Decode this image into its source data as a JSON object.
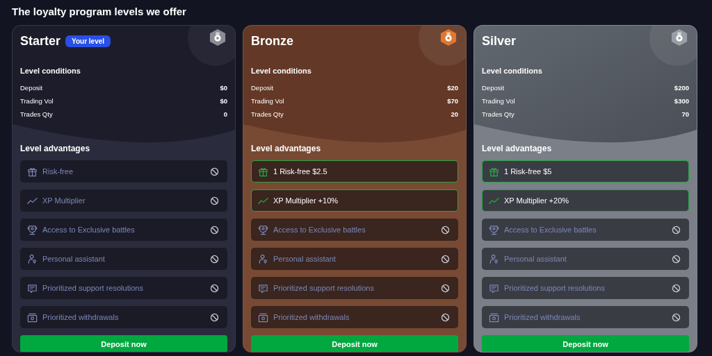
{
  "heading": "The loyalty program levels we offer",
  "levels": [
    {
      "kind": "starter",
      "name": "Starter",
      "badge": "Your level",
      "conditions_title": "Level conditions",
      "conditions": [
        {
          "label": "Deposit",
          "value": "$0"
        },
        {
          "label": "Trading Vol",
          "value": "$0"
        },
        {
          "label": "Trades Qty",
          "value": "0"
        }
      ],
      "advantages_title": "Level advantages",
      "advantages": [
        {
          "kind": "gift",
          "label": "Risk-free",
          "unlocked": false
        },
        {
          "kind": "trend",
          "label": "XP Multiplier",
          "unlocked": false
        },
        {
          "kind": "trophy",
          "label": "Access to Exclusive battles",
          "unlocked": false
        },
        {
          "kind": "person",
          "label": "Personal assistant",
          "unlocked": false
        },
        {
          "kind": "chat",
          "label": "Prioritized support resolutions",
          "unlocked": false
        },
        {
          "kind": "wallet",
          "label": "Prioritized withdrawals",
          "unlocked": false
        }
      ],
      "button": "Deposit now"
    },
    {
      "kind": "bronze",
      "name": "Bronze",
      "conditions_title": "Level conditions",
      "conditions": [
        {
          "label": "Deposit",
          "value": "$20"
        },
        {
          "label": "Trading Vol",
          "value": "$70"
        },
        {
          "label": "Trades Qty",
          "value": "20"
        }
      ],
      "advantages_title": "Level advantages",
      "advantages": [
        {
          "kind": "gift",
          "label": "1 Risk-free $2.5",
          "unlocked": true
        },
        {
          "kind": "trend",
          "label": "XP Multiplier +10%",
          "unlocked": true
        },
        {
          "kind": "trophy",
          "label": "Access to Exclusive battles",
          "unlocked": false
        },
        {
          "kind": "person",
          "label": "Personal assistant",
          "unlocked": false
        },
        {
          "kind": "chat",
          "label": "Prioritized support resolutions",
          "unlocked": false
        },
        {
          "kind": "wallet",
          "label": "Prioritized withdrawals",
          "unlocked": false
        }
      ],
      "button": "Deposit now"
    },
    {
      "kind": "silver",
      "name": "Silver",
      "conditions_title": "Level conditions",
      "conditions": [
        {
          "label": "Deposit",
          "value": "$200"
        },
        {
          "label": "Trading Vol",
          "value": "$300"
        },
        {
          "label": "Trades Qty",
          "value": "70"
        }
      ],
      "advantages_title": "Level advantages",
      "advantages": [
        {
          "kind": "gift",
          "label": "1 Risk-free $5",
          "unlocked": true
        },
        {
          "kind": "trend",
          "label": "XP Multiplier +20%",
          "unlocked": true
        },
        {
          "kind": "trophy",
          "label": "Access to Exclusive battles",
          "unlocked": false
        },
        {
          "kind": "person",
          "label": "Personal assistant",
          "unlocked": false
        },
        {
          "kind": "chat",
          "label": "Prioritized support resolutions",
          "unlocked": false
        },
        {
          "kind": "wallet",
          "label": "Prioritized withdrawals",
          "unlocked": false
        }
      ],
      "button": "Deposit now"
    }
  ]
}
